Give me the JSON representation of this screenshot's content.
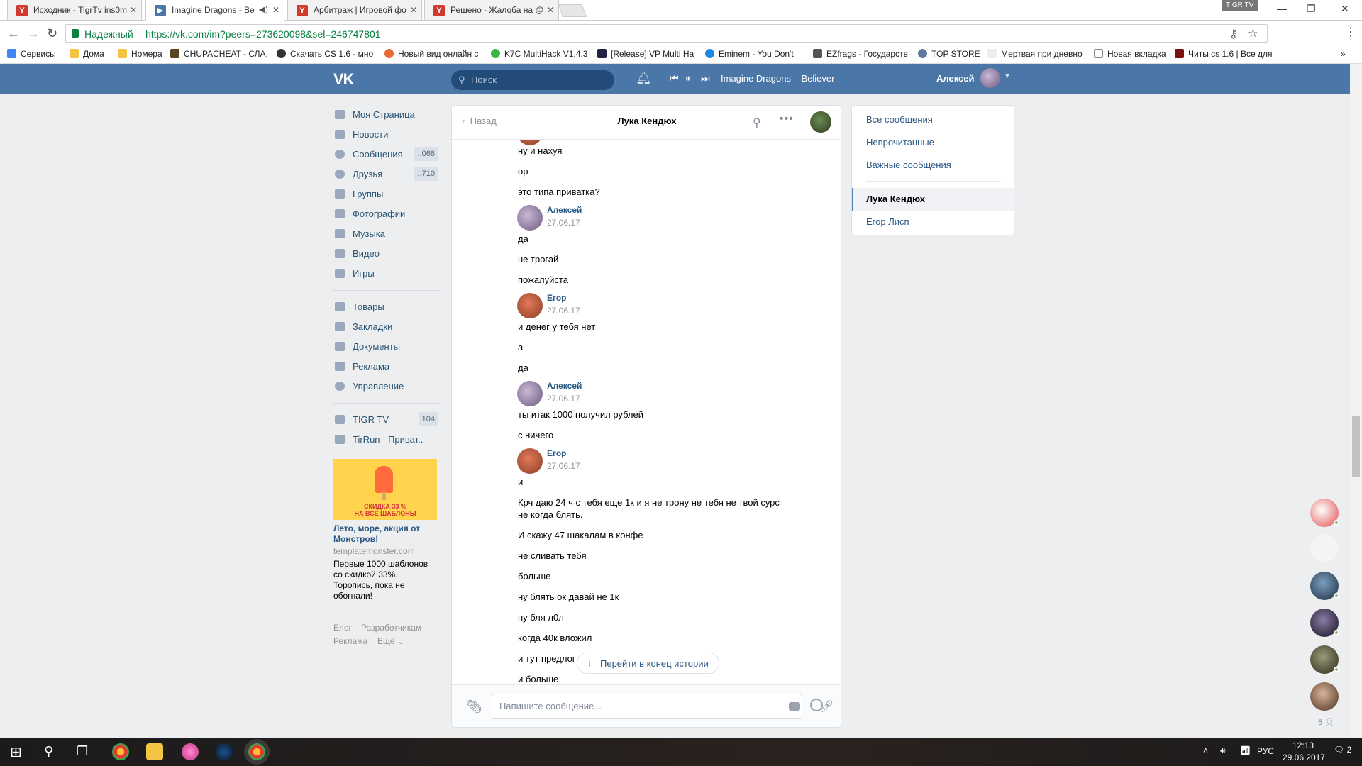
{
  "browser": {
    "tabs": [
      {
        "title": "Исходник - TigrTv ins0m",
        "fav_color": "#d23a2d",
        "fav_letter": "Y"
      },
      {
        "title": "Imagine Dragons - Be",
        "fav_color": "#4a76a8",
        "fav_letter": "▶"
      },
      {
        "title": "Арбитраж | Игровой фо",
        "fav_color": "#d23a2d",
        "fav_letter": "Y"
      },
      {
        "title": "Решено - Жалоба на @",
        "fav_color": "#d23a2d",
        "fav_letter": "Y"
      }
    ],
    "window_user": "TIGR TV",
    "secure_label": "Надежный",
    "url": "https://vk.com/im?peers=273620098&sel=246747801",
    "bookmarks": [
      "Сервисы",
      "Дома",
      "Номера",
      "CHUPACHEAT - СЛА,",
      "Скачать CS 1.6 - мно",
      "Новый вид онлайн с",
      "K7C MultiHack V1.4.3",
      "[Release] VP Multi Ha",
      "Eminem - You Don't",
      "EZfrags - Государств",
      "TOP STORE",
      "Мертвая при дневно",
      "Новая вкладка",
      "Читы cs 1.6 | Все для"
    ]
  },
  "vk_header": {
    "logo": "VK",
    "search_placeholder": "Поиск",
    "track": "Imagine Dragons – Believer",
    "user_name": "Алексей"
  },
  "left_menu": {
    "items": [
      {
        "label": "Моя Страница",
        "count": ""
      },
      {
        "label": "Новости",
        "count": ""
      },
      {
        "label": "Сообщения",
        "count": "..068"
      },
      {
        "label": "Друзья",
        "count": "..710"
      },
      {
        "label": "Группы",
        "count": ""
      },
      {
        "label": "Фотографии",
        "count": ""
      },
      {
        "label": "Музыка",
        "count": ""
      },
      {
        "label": "Видео",
        "count": ""
      },
      {
        "label": "Игры",
        "count": ""
      }
    ],
    "items2": [
      {
        "label": "Товары"
      },
      {
        "label": "Закладки"
      },
      {
        "label": "Документы"
      },
      {
        "label": "Реклама"
      },
      {
        "label": "Управление"
      }
    ],
    "groups": [
      {
        "label": "TIGR TV",
        "count": "104"
      },
      {
        "label": "TirRun - Приват..",
        "count": ""
      }
    ],
    "ad": {
      "banner_text": "СКИДКА 33 %\nНА ВСЕ ШАБЛОНЫ",
      "title": "Лето, море, акция от Монстров!",
      "domain": "templatemonster.com",
      "desc": "Первые 1000 шаблонов со скидкой 33%. Торопись, пока не обогнали!"
    },
    "footer": {
      "blog": "Блог",
      "dev": "Разработчикам",
      "ads": "Реклама",
      "more": "Ещё"
    }
  },
  "dialog": {
    "back_label": "Назад",
    "title": "Лука Кендюх",
    "messages_top": [
      "ну и нахуя",
      "ор",
      "это типа приватка?"
    ],
    "groups": [
      {
        "author": "Алексей",
        "date": "27.06.17",
        "lines": [
          "да",
          "не трогай",
          "пожалуйста"
        ]
      },
      {
        "author": "Егор",
        "date": "27.06.17",
        "lines": [
          "и денег у тебя нет",
          "а",
          "да"
        ]
      },
      {
        "author": "Алексей",
        "date": "27.06.17",
        "lines": [
          "ты итак 1000 получил рублей",
          "с ничего"
        ]
      },
      {
        "author": "Егор",
        "date": "27.06.17",
        "lines": [
          "и",
          "Крч даю 24 ч с тебя еще 1к и я не трону не тебя не твой сурс",
          "не когда блять.",
          "И скажу 47 шакалам в конфе",
          "не сливать тебя",
          "больше",
          "ну блять ок давай не 1к",
          "ну бля л0л",
          "когда 40к вложил",
          "и тут предлог",
          "и больше"
        ]
      }
    ],
    "jump_label": "Перейти в конец истории",
    "compose_placeholder": "Напишите сообщение..."
  },
  "right_menu": {
    "items": [
      "Все сообщения",
      "Непрочитанные",
      "Важные сообщения"
    ],
    "dialogs": [
      "Лука Кендюх",
      "Егор Лисп"
    ]
  },
  "friends_count": "5",
  "taskbar": {
    "lang": "РУС",
    "time": "12:13",
    "date": "29.06.2017",
    "notif_count": "2"
  }
}
